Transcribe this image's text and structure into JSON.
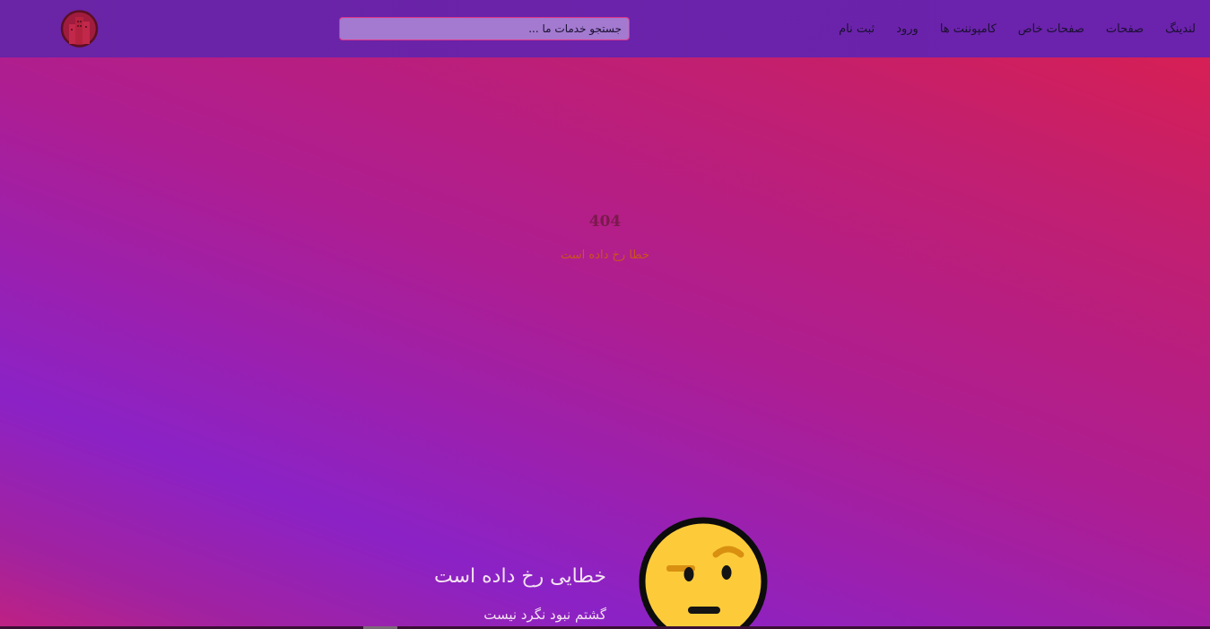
{
  "nav": {
    "links": [
      {
        "label": "لندینگ"
      },
      {
        "label": "صفحات"
      },
      {
        "label": "صفحات خاص"
      },
      {
        "label": "کامپوننت ها"
      },
      {
        "label": "ورود"
      },
      {
        "label": "ثبت نام"
      }
    ],
    "search": {
      "placeholder": "جستجو خدمات ما ..."
    },
    "logo_icon": "building-logo-icon"
  },
  "error": {
    "code": "404",
    "subtitle": "خطا رخ داده است"
  },
  "notice": {
    "title": "خطایی رخ داده است",
    "description": "گشتم نبود نگرد نیست",
    "icon": "raised-eyebrow-emoji-icon"
  },
  "colors": {
    "navbar": "#6a22aa",
    "search_bg": "#a37ad0",
    "search_border": "#e0368a",
    "error_code": "#7a1a4c",
    "error_subtitle": "#c9541e",
    "emoji_face": "#fdcb3a"
  }
}
